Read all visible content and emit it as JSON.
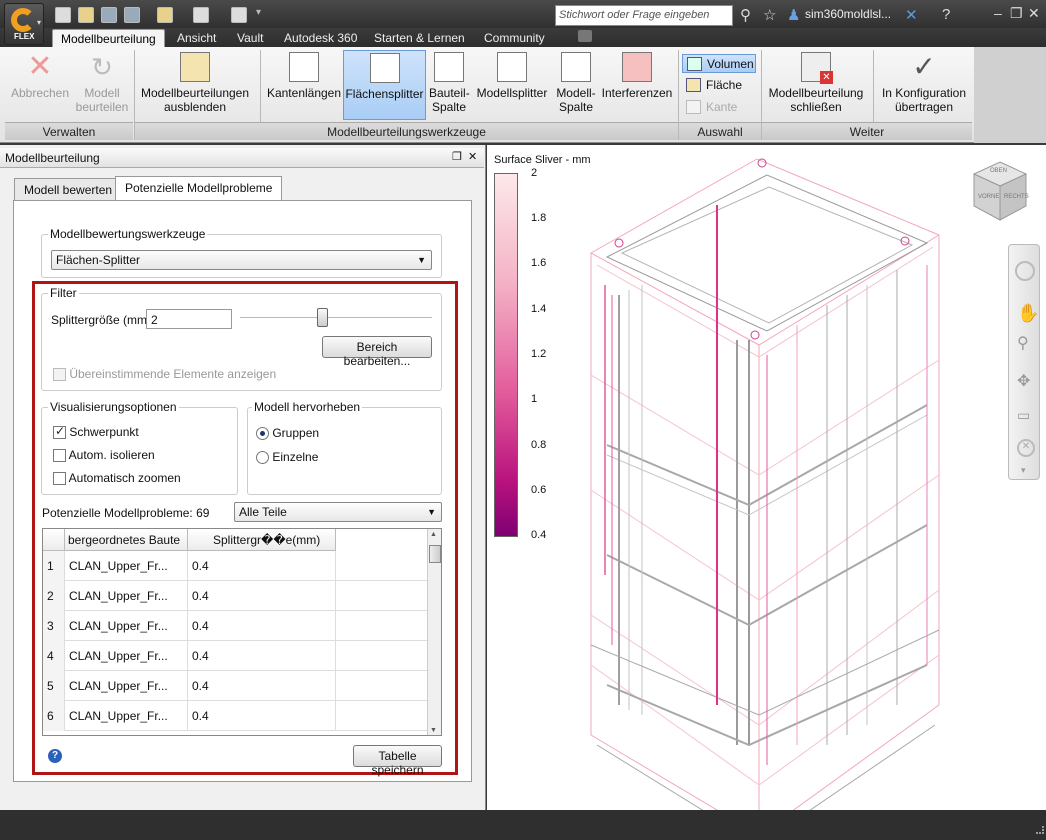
{
  "app": {
    "logo_text": "FLEX"
  },
  "titlebar": {
    "search_placeholder": "Stichwort oder Frage eingeben",
    "user": "sim360moldlsl..."
  },
  "menu_tabs": [
    "Modellbeurteilung",
    "Ansicht",
    "Vault",
    "Autodesk 360",
    "Starten & Lernen",
    "Community"
  ],
  "ribbon": {
    "buttons": {
      "abbrechen": "Abbrechen",
      "modell_beurteilen": "Modell beurteilen",
      "ausblenden": "Modellbeurteilungen ausblenden",
      "kantenlaengen": "Kantenlängen",
      "flaechensplitter": "Flächensplitter",
      "bauteil_spalte": "Bauteil-Spalte",
      "modellsplitter": "Modellsplitter",
      "modell_spalte": "Modell-Spalte",
      "interferenzen": "Interferenzen",
      "volumen": "Volumen",
      "flaeche": "Fläche",
      "kante": "Kante",
      "schliessen": "Modellbeurteilung schließen",
      "konfiguration": "In Konfiguration übertragen"
    },
    "groups": {
      "verwalten": "Verwalten",
      "werkzeuge": "Modellbeurteilungswerkzeuge",
      "auswahl": "Auswahl",
      "weiter": "Weiter"
    }
  },
  "panel": {
    "title": "Modellbeurteilung",
    "tabs": [
      "Modell bewerten",
      "Potenzielle Modellprobleme"
    ],
    "tools_legend": "Modellbewertungswerkzeuge",
    "tools_value": "Flächen-Splitter",
    "filter": {
      "legend": "Filter",
      "size_label": "Splittergröße (mm)",
      "size_value": "2",
      "slider_value_mm": 2,
      "edit_button": "Bereich bearbeiten...",
      "match_label": "Übereinstimmende Elemente anzeigen"
    },
    "vis": {
      "legend": "Visualisierungsoptionen",
      "options": [
        "Schwerpunkt",
        "Autom. isolieren",
        "Automatisch zoomen"
      ]
    },
    "highlight": {
      "legend": "Modell hervorheben",
      "options": [
        "Gruppen",
        "Einzelne"
      ]
    },
    "problems_label": "Potenzielle Modellprobleme: 69",
    "problems_filter": "Alle Teile",
    "table": {
      "headers": [
        "bergeordnetes Baute",
        "Splittergr��e(mm)"
      ],
      "rows": [
        {
          "n": "1",
          "part": "CLAN_Upper_Fr...",
          "size": "0.4"
        },
        {
          "n": "2",
          "part": "CLAN_Upper_Fr...",
          "size": "0.4"
        },
        {
          "n": "3",
          "part": "CLAN_Upper_Fr...",
          "size": "0.4"
        },
        {
          "n": "4",
          "part": "CLAN_Upper_Fr...",
          "size": "0.4"
        },
        {
          "n": "5",
          "part": "CLAN_Upper_Fr...",
          "size": "0.4"
        },
        {
          "n": "6",
          "part": "CLAN_Upper_Fr...",
          "size": "0.4"
        }
      ]
    },
    "save_button": "Tabelle speichern"
  },
  "viewport": {
    "legend_title": "Surface Sliver - mm",
    "ticks": [
      "2",
      "1.8",
      "1.6",
      "1.4",
      "1.2",
      "1",
      "0.8",
      "0.6",
      "0.4"
    ],
    "viewcube": {
      "top": "OBEN",
      "front": "VORNE",
      "right": "RECHTS"
    }
  }
}
